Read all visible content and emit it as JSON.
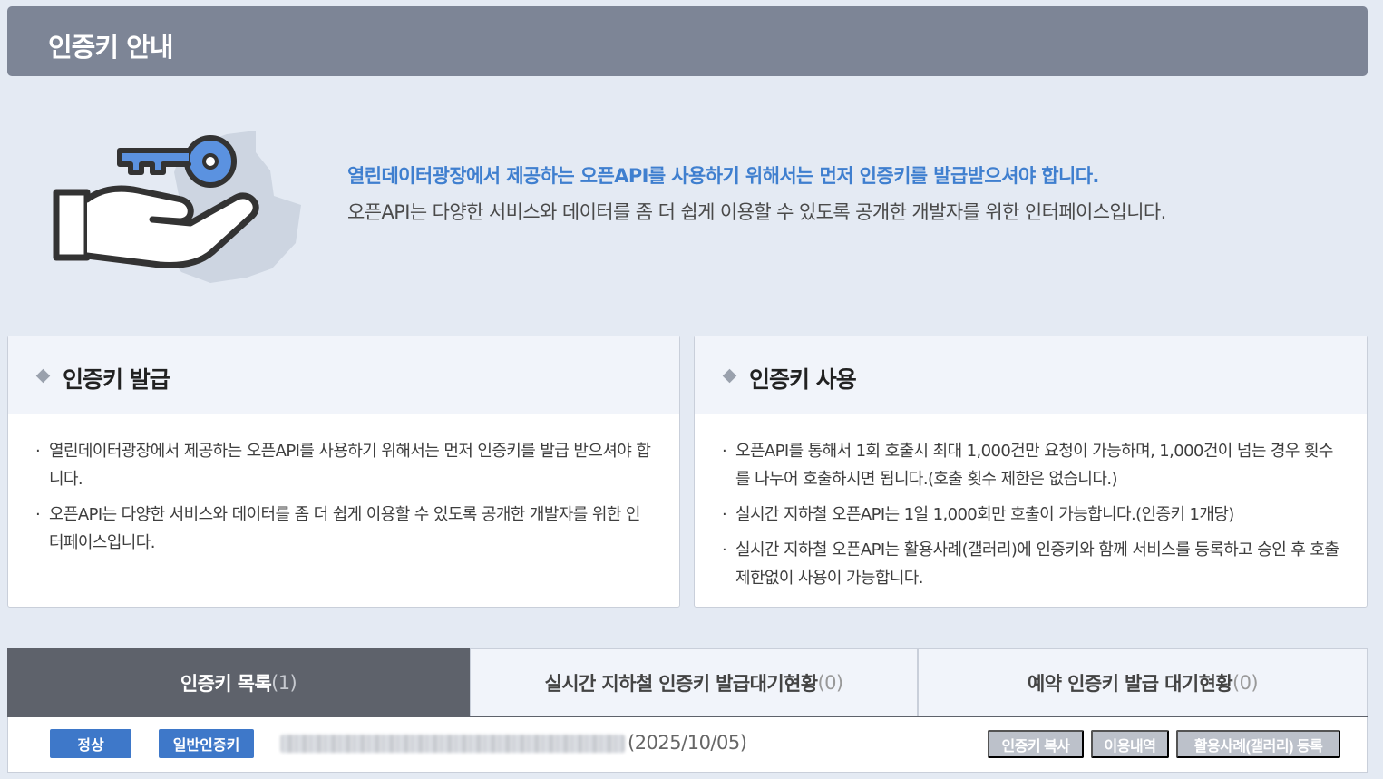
{
  "header": {
    "title": "인증키 안내"
  },
  "intro": {
    "line1": "열린데이터광장에서 제공하는 오픈API를 사용하기 위해서는 먼저 인증키를 발급받으셔야 합니다.",
    "line2": "오픈API는 다양한 서비스와 데이터를 좀 더 쉽게 이용할 수 있도록 공개한 개발자를 위한 인터페이스입니다.",
    "illustration_icon": "hand-holding-key-icon",
    "accent_color": "#3f7fcf"
  },
  "issue_box": {
    "title": "인증키 발급",
    "items": [
      "열린데이터광장에서 제공하는 오픈API를 사용하기 위해서는 먼저 인증키를 발급 받으셔야 합니다.",
      "오픈API는 다양한 서비스와 데이터를 좀 더 쉽게 이용할 수 있도록 공개한 개발자를 위한 인터페이스입니다."
    ]
  },
  "usage_box": {
    "title": "인증키 사용",
    "items": [
      "오픈API를 통해서 1회 호출시 최대 1,000건만 요청이 가능하며, 1,000건이 넘는 경우 횟수를 나누어 호출하시면 됩니다.(호출 횟수 제한은 없습니다.)",
      "실시간 지하철 오픈API는 1일 1,000회만 호출이 가능합니다.(인증키 1개당)",
      "실시간 지하철 오픈API는 활용사례(갤러리)에 인증키와 함께 서비스를 등록하고 승인 후 호출 제한없이 사용이 가능합니다."
    ]
  },
  "tabs": [
    {
      "label": "인증키 목록",
      "count": "(1)",
      "active": true
    },
    {
      "label": "실시간 지하철 인증키 발급대기현황",
      "count": "(0)",
      "active": false
    },
    {
      "label": "예약 인증키 발급 대기현황",
      "count": "(0)",
      "active": false
    }
  ],
  "key_row": {
    "status": "정상",
    "type": "일반인증키",
    "expiry": "(2025/10/05)",
    "buttons": {
      "copy": "인증키 복사",
      "usage": "이용내역",
      "gallery": "활용사례(갤러리) 등록"
    }
  },
  "colors": {
    "title_bar": "#7d8596",
    "badge_blue": "#3e78c9",
    "active_tab": "#5e626b",
    "gray_button": "#bcc1ca"
  }
}
